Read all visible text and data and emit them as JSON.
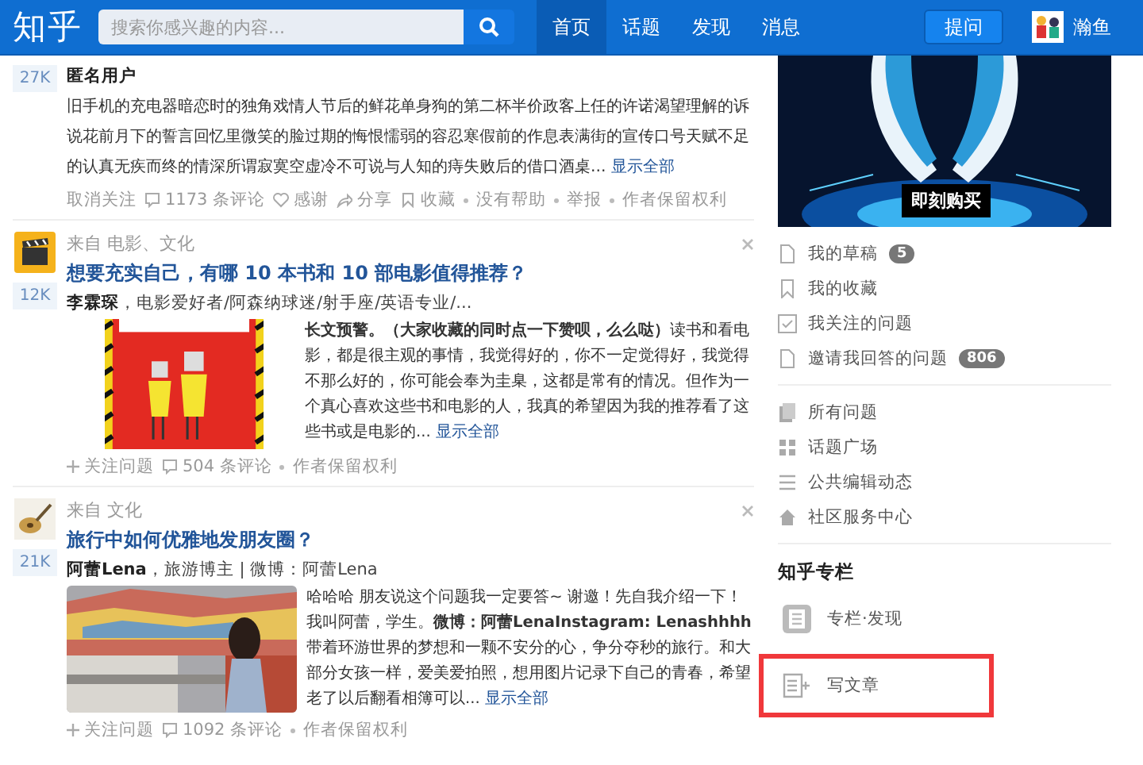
{
  "header": {
    "logo": "知乎",
    "search": {
      "placeholder": "搜索你感兴趣的内容..."
    },
    "nav": [
      {
        "label": "首页",
        "selected": true
      },
      {
        "label": "话题",
        "selected": false
      },
      {
        "label": "发现",
        "selected": false
      },
      {
        "label": "消息",
        "selected": false
      }
    ],
    "ask_button": "提问",
    "user": {
      "name": "瀚鱼"
    }
  },
  "feed": [
    {
      "votes": "27K",
      "author": "匿名用户",
      "excerpt": "旧手机的充电器暗恋时的独角戏情人节后的鲜花单身狗的第二杯半价政客上任的许诺渴望理解的诉说花前月下的誓言回忆里微笑的脸过期的悔恨懦弱的容忍寒假前的作息表满街的宣传口号天赋不足的认真无疾而终的情深所谓寂寞空虚冷不可说与人知的痔失败后的借口酒桌...",
      "more": "显示全部",
      "actions": [
        {
          "kind": "text",
          "label": "取消关注"
        },
        {
          "kind": "comment",
          "label": "1173 条评论"
        },
        {
          "kind": "heart",
          "label": "感谢"
        },
        {
          "kind": "share",
          "label": "分享"
        },
        {
          "kind": "bookmark",
          "label": "收藏"
        },
        {
          "kind": "dot",
          "label": "没有帮助"
        },
        {
          "kind": "dot",
          "label": "举报"
        },
        {
          "kind": "dot",
          "label": "作者保留权利"
        }
      ]
    },
    {
      "topic": "来自 电影、文化",
      "title": "想要充实自己，有哪 10 本书和 10 部电影值得推荐？",
      "votes": "12K",
      "author": "李霖琛",
      "author_bio": "，电影爱好者/阿森纳球迷/射手座/英语专业/...",
      "excerpt": "**长文预警。（大家收藏的同时点一下赞呗，么么哒）**读书和看电影，都是很主观的事情，我觉得好的，你不一定觉得好，我觉得不那么好的，你可能会奉为圭臬，这都是常有的情况。但作为一个真心喜欢这些书和电影的人，我真的希望因为我的推荐看了这些书或是电影的...",
      "more": "显示全部",
      "actions": [
        {
          "kind": "plus",
          "label": "关注问题"
        },
        {
          "kind": "comment",
          "label": "504 条评论"
        },
        {
          "kind": "dot",
          "label": "作者保留权利"
        }
      ]
    },
    {
      "topic": "来自 文化",
      "title": "旅行中如何优雅地发朋友圈？",
      "votes": "21K",
      "author": "阿蕾Lena",
      "author_bio": "，旅游博主 | 微博：阿蕾Lena",
      "excerpt": "哈哈哈 朋友说这个问题我一定要答~ 谢邀！先自我介绍一下！我叫阿蕾，学生。**微博：阿蕾LenaInstagram: Lenashhhh**带着环游世界的梦想和一颗不安分的心，争分夺秒的旅行。和大部分女孩一样，爱美爱拍照，想用图片记录下自己的青春，希望老了以后翻看相簿可以...",
      "more": "显示全部",
      "actions": [
        {
          "kind": "plus",
          "label": "关注问题"
        },
        {
          "kind": "comment",
          "label": "1092 条评论"
        },
        {
          "kind": "dot",
          "label": "作者保留权利"
        }
      ]
    }
  ],
  "sidebar": {
    "ad": {
      "button": "即刻购买"
    },
    "groups": [
      [
        {
          "label": "我的草稿",
          "badge": "5"
        },
        {
          "label": "我的收藏"
        },
        {
          "label": "我关注的问题"
        },
        {
          "label": "邀请我回答的问题",
          "badge": "806"
        }
      ],
      [
        {
          "label": "所有问题"
        },
        {
          "label": "话题广场"
        },
        {
          "label": "公共编辑动态"
        },
        {
          "label": "社区服务中心"
        }
      ]
    ],
    "column": {
      "title": "知乎专栏",
      "items": [
        {
          "label": "专栏·发现",
          "highlighted": false
        },
        {
          "label": "写文章",
          "highlighted": true
        }
      ]
    }
  }
}
